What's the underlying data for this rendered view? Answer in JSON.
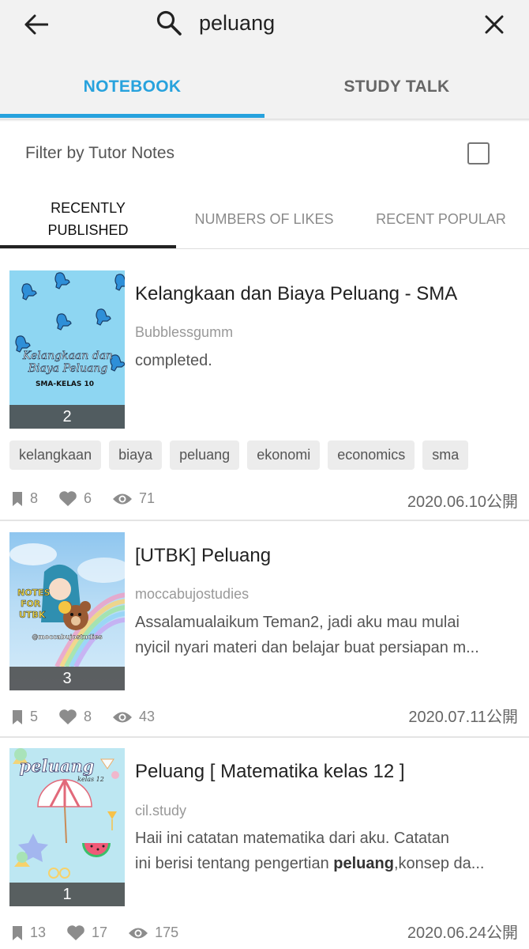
{
  "search": {
    "query": "peluang"
  },
  "main_tabs": [
    {
      "label": "NOTEBOOK",
      "active": true
    },
    {
      "label": "STUDY TALK",
      "active": false
    }
  ],
  "filter": {
    "label": "Filter by Tutor Notes",
    "checked": false
  },
  "sort_tabs": [
    {
      "line1": "RECENTLY",
      "line2": "PUBLISHED",
      "active": true
    },
    {
      "label": "NUMBERS OF LIKES",
      "active": false
    },
    {
      "label": "RECENT POPULAR",
      "active": false
    }
  ],
  "notes": [
    {
      "title": "Kelangkaan dan Biaya Peluang - SMA",
      "author": "Bubblessgumm",
      "excerpt_lines": [
        "completed."
      ],
      "page_count": "2",
      "cover": {
        "line1": "Kelangkaan dan",
        "line2": "Biaya Peluang",
        "line3": "SMA-KELAS 10"
      },
      "tags": [
        "kelangkaan",
        "biaya",
        "peluang",
        "ekonomi",
        "economics",
        "sma"
      ],
      "bookmarks": "8",
      "likes": "6",
      "views": "71",
      "date": "2020.06.10公開"
    },
    {
      "title": "[UTBK] Peluang",
      "author": "moccabujostudies",
      "excerpt_lines": [
        "Assalamualaikum Teman2, jadi aku mau mulai",
        "nyicil nyari materi dan belajar buat persiapan m..."
      ],
      "page_count": "3",
      "cover": {
        "line1": "NOTES",
        "line2": "FOR",
        "line3": "UTBK",
        "line4": "@moccabujostudies"
      },
      "bookmarks": "5",
      "likes": "8",
      "views": "43",
      "date": "2020.07.11公開"
    },
    {
      "title": "Peluang [ Matematika kelas 12 ]",
      "author": "cil.study",
      "excerpt_line1": "Haii ini catatan matematika dari aku. Catatan",
      "excerpt_line2_pre": "ini berisi tentang pengertian ",
      "excerpt_line2_bold": "peluang",
      "excerpt_line2_post": ",konsep da...",
      "page_count": "1",
      "cover": {
        "line1": "peluang",
        "line2": "kelas 12"
      },
      "bookmarks": "13",
      "likes": "17",
      "views": "175",
      "date": "2020.06.24公開"
    }
  ],
  "colors": {
    "accent": "#27a2dd",
    "topbar": "#f2f2f2",
    "icon_gray": "#8c8c8c"
  }
}
